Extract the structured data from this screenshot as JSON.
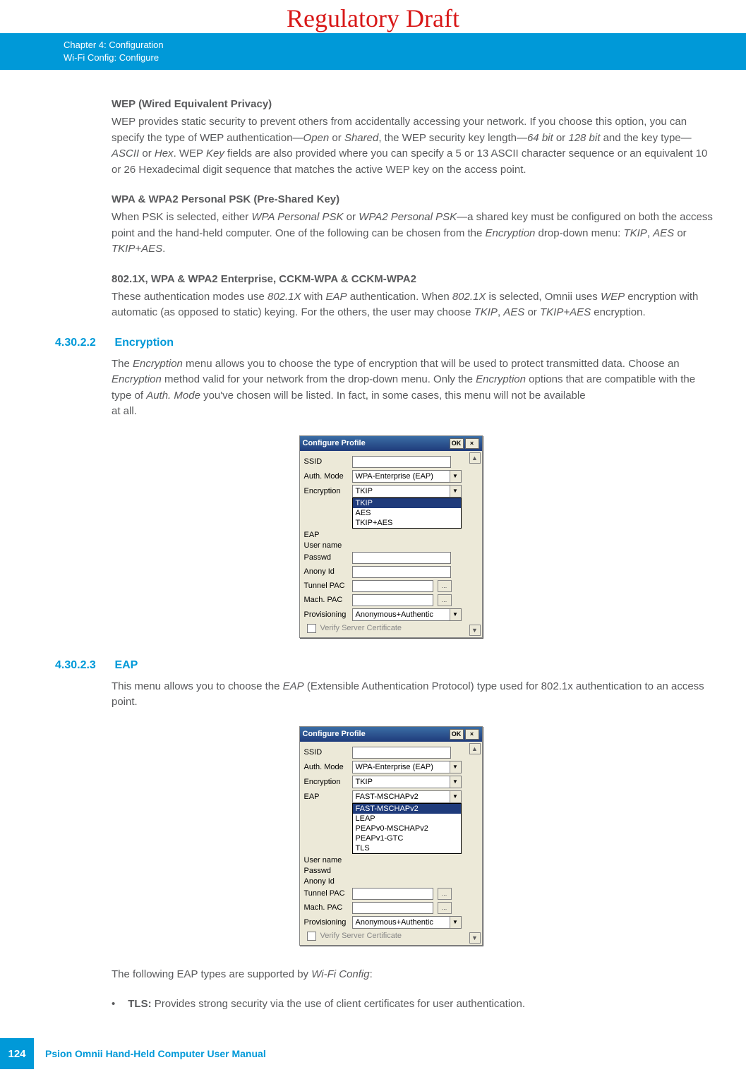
{
  "watermark": "Regulatory Draft",
  "header": {
    "chapter": "Chapter 4:  Configuration",
    "section": "Wi-Fi Config: Configure"
  },
  "wep": {
    "title": "WEP (Wired Equivalent Privacy)",
    "text_1": "WEP provides static security to prevent others from accidentally accessing your network. If you choose this option, you can specify the type of WEP authentication—",
    "i1": "Open",
    "or1": " or ",
    "i2": "Shared",
    "text_2": ", the WEP security key length—",
    "i3": "64 bit",
    "or2": " or ",
    "i4": "128 bit",
    "text_3": " and the key type—",
    "i5": "ASCII",
    "or3": " or ",
    "i6": "Hex",
    "text_4": ". WEP ",
    "i7": "Key",
    "text_5": " fields are also provided where you can specify a 5 or 13 ASCII character sequence or an equivalent 10 or 26 Hexadecimal digit sequence that matches the active WEP key on the access point."
  },
  "wpa": {
    "title": "WPA & WPA2 Personal PSK (Pre-Shared Key)",
    "t1": "When PSK is selected, either ",
    "i1": "WPA Personal PSK",
    "or1": " or ",
    "i2": "WPA2 Personal PSK",
    "t2": "—a shared key must be configured on both the access point and the hand-held computer. One of the following can be chosen from the ",
    "i3": "Encryption",
    "t3": " drop-down menu: ",
    "i4": "TKIP",
    "c1": ", ",
    "i5": "AES",
    "or2": " or ",
    "i6": "TKIP+AES",
    "t4": "."
  },
  "ent": {
    "title": "802.1X, WPA & WPA2 Enterprise, CCKM-WPA & CCKM-WPA2",
    "t1": "These authentication modes use ",
    "i1": "802.1X",
    "t2": " with ",
    "i2": "EAP",
    "t3": " authentication. When ",
    "i3": "802.1X",
    "t4": " is selected, Omnii uses ",
    "i4": "WEP",
    "t5": " encryption with automatic (as opposed to static) keying. For the others, the user may choose ",
    "i5": "TKIP",
    "c1": ", ",
    "i6": "AES",
    "or1": " or ",
    "i7": "TKIP+AES",
    "t6": " encryption."
  },
  "sec_encryption": {
    "num": "4.30.2.2",
    "title": "Encryption",
    "t1": "The ",
    "i1": "Encryption",
    "t2": " menu allows you to choose the type of encryption that will be used to protect transmitted data. Choose an ",
    "i2": "Encryption",
    "t3": " method valid for your network from the drop-down menu. Only the ",
    "i3": "Encryption",
    "t4": " options that are compatible with the type of ",
    "i4": "Auth. Mode",
    "t5": " you've chosen will be listed. In fact, in some cases, this menu will not be available",
    "t6": "at all."
  },
  "sec_eap": {
    "num": "4.30.2.3",
    "title": "EAP",
    "t1": "This menu allows you to choose the ",
    "i1": "EAP",
    "t2": " (Extensible Authentication Protocol) type used for 802.1x authentication to an access point.",
    "after1": "The following EAP types are supported by ",
    "after_i1": "Wi-Fi Config",
    "after2": ":",
    "bullet_label": "TLS:",
    "bullet_text": " Provides strong security via the use of client certificates for user authentication."
  },
  "dlg": {
    "title": "Configure Profile",
    "ok": "OK",
    "close": "×",
    "labels": {
      "ssid": "SSID",
      "auth": "Auth. Mode",
      "enc": "Encryption",
      "eap": "EAP",
      "user": "User name",
      "pass": "Passwd",
      "anon": "Anony Id",
      "tpac": "Tunnel PAC",
      "mpac": "Mach. PAC",
      "prov": "Provisioning",
      "verify": "Verify Server Certificate"
    },
    "auth_val": "WPA-Enterprise (EAP)",
    "enc_val": "TKIP",
    "prov_val": "Anonymous+Authentic",
    "ellipsis": "...",
    "enc_opts": [
      "TKIP",
      "AES",
      "TKIP+AES"
    ],
    "eap_val": "FAST-MSCHAPv2",
    "eap_opts": [
      "FAST-MSCHAPv2",
      "LEAP",
      "PEAPv0-MSCHAPv2",
      "PEAPv1-GTC",
      "TLS"
    ]
  },
  "footer": {
    "page": "124",
    "text": "Psion Omnii Hand-Held Computer User Manual"
  }
}
